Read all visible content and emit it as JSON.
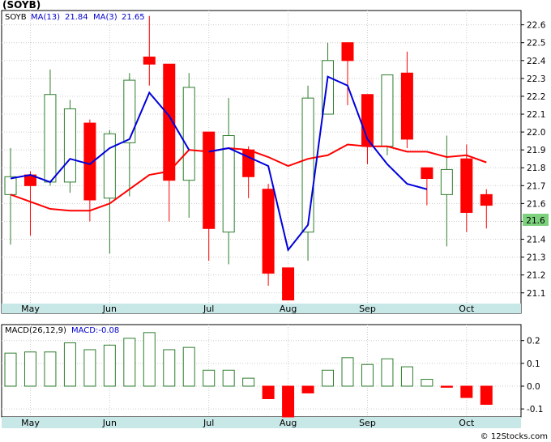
{
  "header": {
    "title": "(SOYB)",
    "legend_symbol": "SOYB",
    "legend_ma13_label": "MA(13)",
    "legend_ma13_value": "21.84",
    "legend_ma3_label": "MA(3)",
    "legend_ma3_value": "21.65"
  },
  "macd_legend": {
    "label": "MACD(26,12,9)",
    "value_label": "MACD:-0.08"
  },
  "last_price_label": "21.6",
  "watermark": "© 12Stocks.com",
  "colors": {
    "up": "#2e7d2e",
    "down": "#ff0000",
    "ma13": "#ff0000",
    "ma3": "#0000dd",
    "grid": "#cccccc",
    "axis_bar": "#c8e8e8",
    "label_box": "#7cd17c"
  },
  "chart_data": [
    {
      "type": "candlestick",
      "y_ticks": [
        "21.1",
        "21.2",
        "21.3",
        "21.4",
        "21.5",
        "21.6",
        "21.7",
        "21.8",
        "21.9",
        "22.0",
        "22.1",
        "22.2",
        "22.3",
        "22.4",
        "22.5",
        "22.6"
      ],
      "ylim": [
        21.04,
        22.68
      ],
      "x_labels": [
        "May",
        "Jun",
        "Jul",
        "Aug",
        "Sep",
        "Oct"
      ],
      "x_label_index": [
        1,
        5,
        10,
        14,
        18,
        23
      ],
      "grid": true,
      "candles": [
        {
          "o": 21.65,
          "c": 21.75,
          "h": 21.91,
          "l": 21.37
        },
        {
          "o": 21.76,
          "c": 21.7,
          "h": 21.78,
          "l": 21.42
        },
        {
          "o": 21.72,
          "c": 22.21,
          "h": 22.35,
          "l": 21.7
        },
        {
          "o": 21.72,
          "c": 22.13,
          "h": 22.18,
          "l": 21.66
        },
        {
          "o": 22.05,
          "c": 21.62,
          "h": 22.07,
          "l": 21.5
        },
        {
          "o": 21.63,
          "c": 21.99,
          "h": 22.01,
          "l": 21.32
        },
        {
          "o": 21.94,
          "c": 22.29,
          "h": 22.33,
          "l": 21.64
        },
        {
          "o": 22.42,
          "c": 22.38,
          "h": 22.65,
          "l": 22.26
        },
        {
          "o": 22.38,
          "c": 21.73,
          "h": 22.38,
          "l": 21.5
        },
        {
          "o": 21.73,
          "c": 22.25,
          "h": 22.33,
          "l": 21.52
        },
        {
          "o": 22.0,
          "c": 21.46,
          "h": 22.0,
          "l": 21.28
        },
        {
          "o": 21.44,
          "c": 21.98,
          "h": 22.19,
          "l": 21.26
        },
        {
          "o": 21.9,
          "c": 21.75,
          "h": 21.92,
          "l": 21.63
        },
        {
          "o": 21.68,
          "c": 21.21,
          "h": 21.71,
          "l": 21.14
        },
        {
          "o": 21.24,
          "c": 21.06,
          "h": 21.24,
          "l": 21.06
        },
        {
          "o": 21.44,
          "c": 22.19,
          "h": 22.26,
          "l": 21.28
        },
        {
          "o": 22.1,
          "c": 22.4,
          "h": 22.5,
          "l": 22.1
        },
        {
          "o": 22.5,
          "c": 22.4,
          "h": 22.5,
          "l": 22.15
        },
        {
          "o": 22.21,
          "c": 21.92,
          "h": 22.21,
          "l": 21.82
        },
        {
          "o": 21.92,
          "c": 22.32,
          "h": 22.32,
          "l": 21.87
        },
        {
          "o": 22.33,
          "c": 21.96,
          "h": 22.45,
          "l": 21.91
        },
        {
          "o": 21.8,
          "c": 21.74,
          "h": 21.8,
          "l": 21.59
        },
        {
          "o": 21.65,
          "c": 21.79,
          "h": 21.98,
          "l": 21.36
        },
        {
          "o": 21.85,
          "c": 21.55,
          "h": 21.93,
          "l": 21.44
        },
        {
          "o": 21.65,
          "c": 21.59,
          "h": 21.68,
          "l": 21.46
        }
      ],
      "ma13": [
        21.65,
        21.61,
        21.57,
        21.56,
        21.56,
        21.6,
        21.68,
        21.76,
        21.78,
        21.9,
        21.89,
        21.91,
        21.9,
        21.86,
        21.81,
        21.85,
        21.87,
        21.93,
        21.92,
        21.92,
        21.89,
        21.89,
        21.86,
        21.87,
        21.83
      ],
      "ma3": [
        21.74,
        21.76,
        21.72,
        21.85,
        21.82,
        21.91,
        21.96,
        22.22,
        22.09,
        21.9,
        21.89,
        21.91,
        21.86,
        21.81,
        21.34,
        21.48,
        22.31,
        22.26,
        21.96,
        21.82,
        21.71,
        21.68
      ]
    },
    {
      "type": "bar",
      "name": "MACD(26,12,9)",
      "y_ticks": [
        "0.2",
        "0.1",
        "0.0",
        "-0.1"
      ],
      "ylim": [
        -0.135,
        0.27
      ],
      "values": [
        0.145,
        0.15,
        0.15,
        0.19,
        0.16,
        0.18,
        0.21,
        0.235,
        0.16,
        0.17,
        0.07,
        0.07,
        0.035,
        -0.055,
        -0.135,
        -0.03,
        0.07,
        0.125,
        0.095,
        0.12,
        0.085,
        0.03,
        -0.005,
        -0.05,
        -0.08
      ]
    }
  ]
}
